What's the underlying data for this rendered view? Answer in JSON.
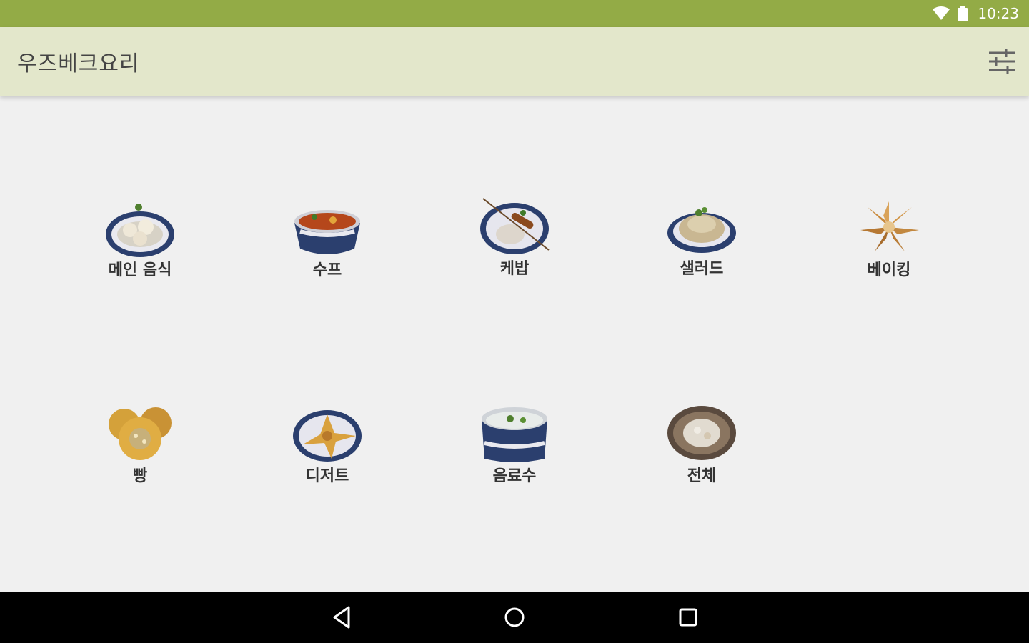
{
  "status_bar": {
    "time": "10:23",
    "icons": [
      "wifi-icon",
      "battery-icon"
    ]
  },
  "app_bar": {
    "title": "우즈베크요리",
    "action_icon": "sliders-icon"
  },
  "categories": [
    {
      "label": "메인 음식",
      "icon": "main-dish-plate-icon"
    },
    {
      "label": "수프",
      "icon": "soup-bowl-icon"
    },
    {
      "label": "케밥",
      "icon": "kebab-plate-icon"
    },
    {
      "label": "샐러드",
      "icon": "salad-plate-icon"
    },
    {
      "label": "베이킹",
      "icon": "baking-icon"
    },
    {
      "label": "빵",
      "icon": "bread-icon"
    },
    {
      "label": "디저트",
      "icon": "dessert-plate-icon"
    },
    {
      "label": "음료수",
      "icon": "drink-bowl-icon"
    },
    {
      "label": "전체",
      "icon": "all-dishes-plate-icon"
    }
  ],
  "nav_bar": {
    "icons": [
      "back-icon",
      "home-icon",
      "recents-icon"
    ]
  },
  "colors": {
    "status_bar": "#93ab46",
    "app_bar": "#e3e7cb",
    "background": "#f0f0f0",
    "plate_blue": "#2b3f6e"
  }
}
